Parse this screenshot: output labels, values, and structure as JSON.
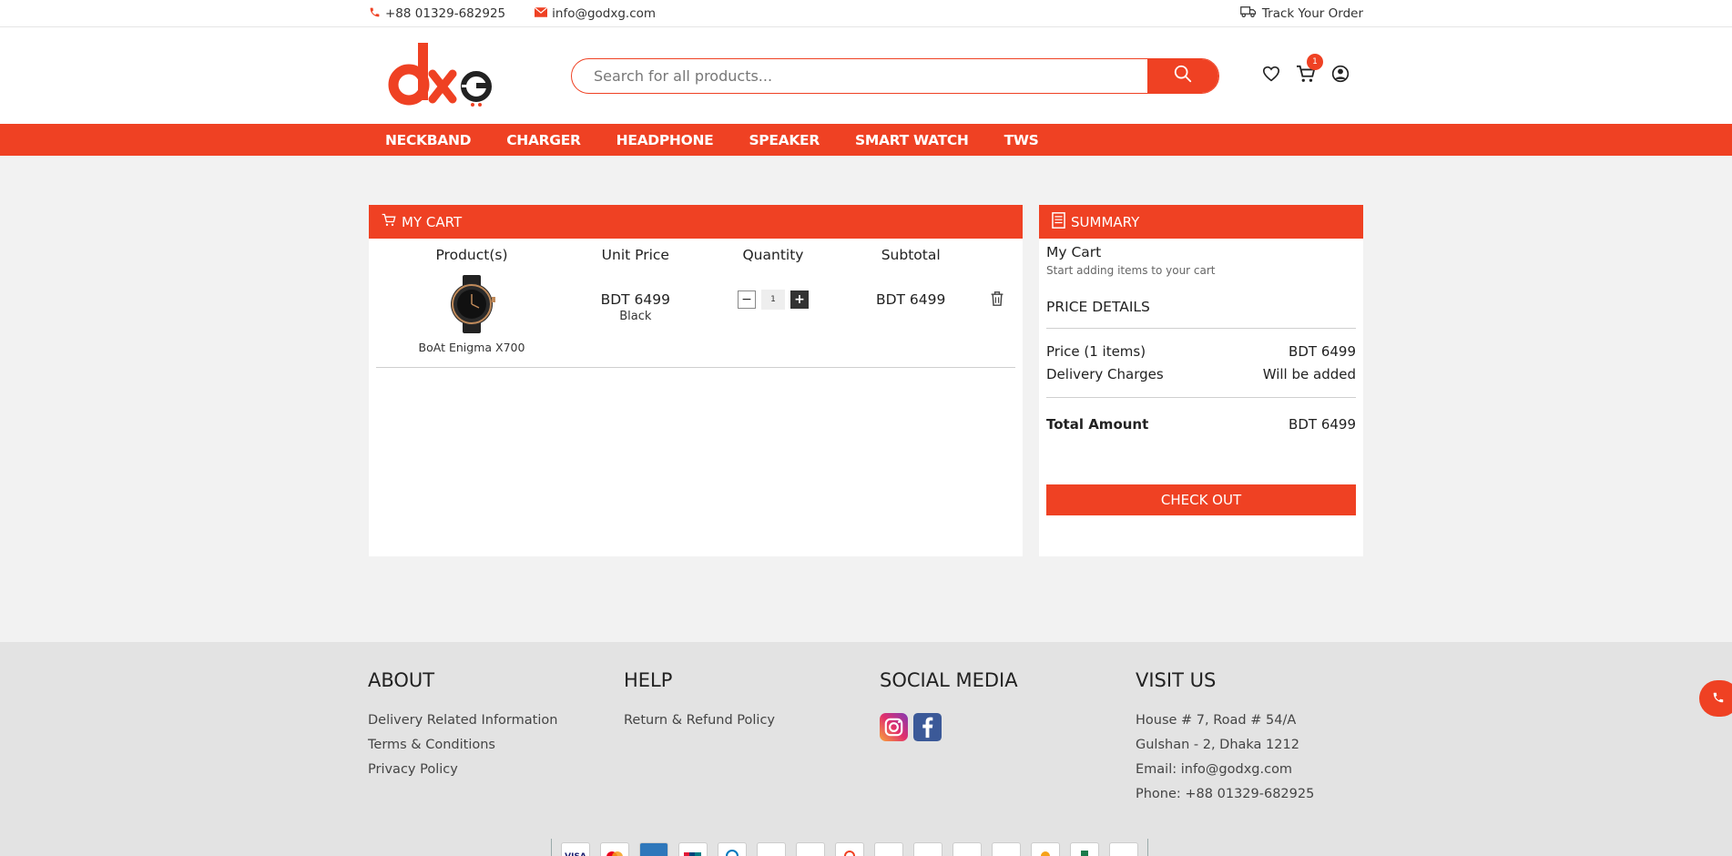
{
  "topbar": {
    "phone": "+88 01329-682925",
    "email": "info@godxg.com",
    "track": "Track Your Order"
  },
  "header": {
    "search_placeholder": "Search for all products...",
    "cart_count": "1"
  },
  "nav": [
    "NECKBAND",
    "CHARGER",
    "HEADPHONE",
    "SPEAKER",
    "SMART WATCH",
    "TWS"
  ],
  "cart": {
    "title": "MY CART",
    "columns": [
      "Product(s)",
      "Unit Price",
      "Quantity",
      "Subtotal"
    ],
    "item": {
      "name": "BoAt Enigma X700",
      "unit_price": "BDT 6499",
      "variant": "Black",
      "quantity": "1",
      "subtotal": "BDT 6499",
      "minus": "−",
      "plus": "+"
    }
  },
  "summary": {
    "title": "SUMMARY",
    "my_cart": "My Cart",
    "hint": "Start adding items to your cart",
    "price_details": "PRICE DETAILS",
    "price_label": "Price (1 items)",
    "price_value": "BDT 6499",
    "delivery_label": "Delivery Charges",
    "delivery_value": "Will be added",
    "total_label": "Total Amount",
    "total_value": "BDT 6499",
    "checkout": "CHECK OUT"
  },
  "footer": {
    "about": {
      "title": "ABOUT",
      "links": [
        "Delivery Related Information",
        "Terms & Conditions",
        "Privacy Policy"
      ]
    },
    "help": {
      "title": "HELP",
      "links": [
        "Return & Refund Policy"
      ]
    },
    "social": {
      "title": "SOCIAL MEDIA",
      "icons": [
        "instagram-icon",
        "facebook-icon"
      ]
    },
    "visit": {
      "title": "VISIT US",
      "lines": [
        "House # 7, Road # 54/A",
        "Gulshan - 2, Dhaka 1212",
        "Email: info@godxg.com",
        "Phone: +88 01329-682925"
      ]
    },
    "payment_labels": [
      "VISA",
      "",
      "",
      "",
      "",
      "",
      "",
      "",
      "",
      "",
      "",
      "",
      "",
      "",
      "",
      ""
    ]
  },
  "colors": {
    "brand": "#ef4123",
    "dark": "#333333",
    "footer_bg": "#e3e3e3"
  }
}
